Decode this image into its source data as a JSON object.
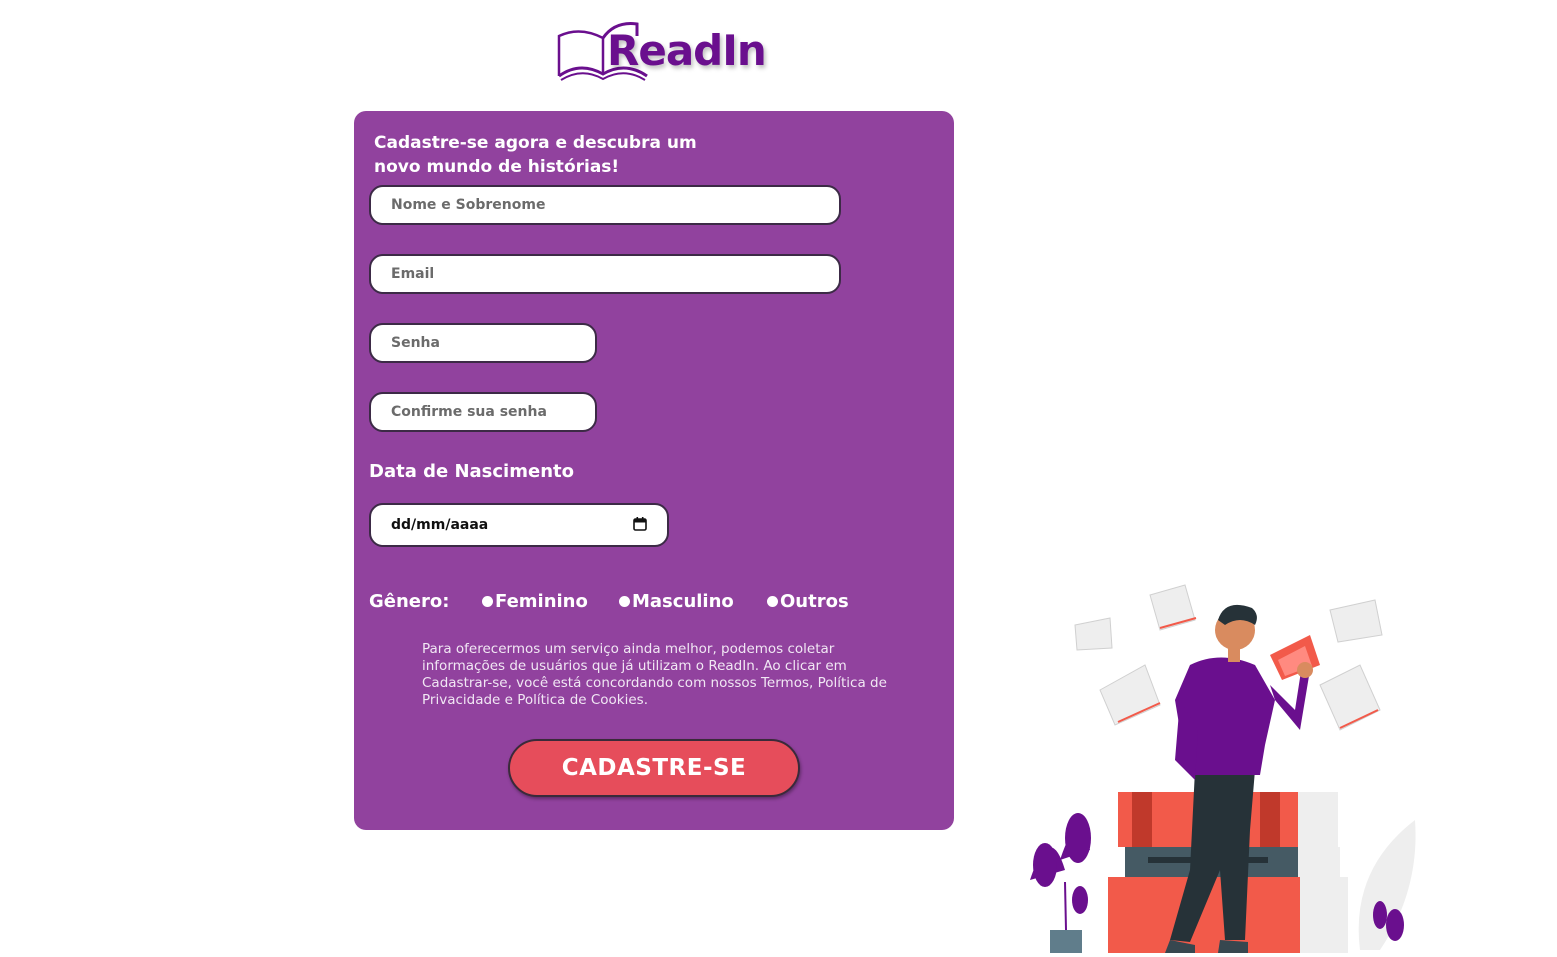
{
  "brand": {
    "name": "ReadIn",
    "color": "#6a0f8e"
  },
  "form": {
    "headline": "Cadastre-se agora e descubra um novo mundo de histórias!",
    "name_placeholder": "Nome e Sobrenome",
    "email_placeholder": "Email",
    "password_placeholder": "Senha",
    "confirm_placeholder": "Confirme sua senha",
    "birth_label": "Data de Nascimento",
    "birth_value": "dd/mm/aaaa",
    "gender_label": "Gênero:",
    "gender_options": [
      "Feminino",
      "Masculino",
      "Outros"
    ],
    "terms": "Para oferecermos um serviço ainda melhor, podemos coletar informações de usuários que já utilizam o ReadIn. Ao clicar em Cadastrar-se, você está concordando com nossos Termos, Política de Privacidade e Política de Cookies.",
    "submit_label": "CADASTRE-SE"
  },
  "colors": {
    "card_bg": "#91429e",
    "button": "#e64d5b",
    "accent_purple": "#6a0f8e",
    "coral": "#f25a4a"
  },
  "illustration": {
    "icon": "reader-with-books-illustration"
  }
}
